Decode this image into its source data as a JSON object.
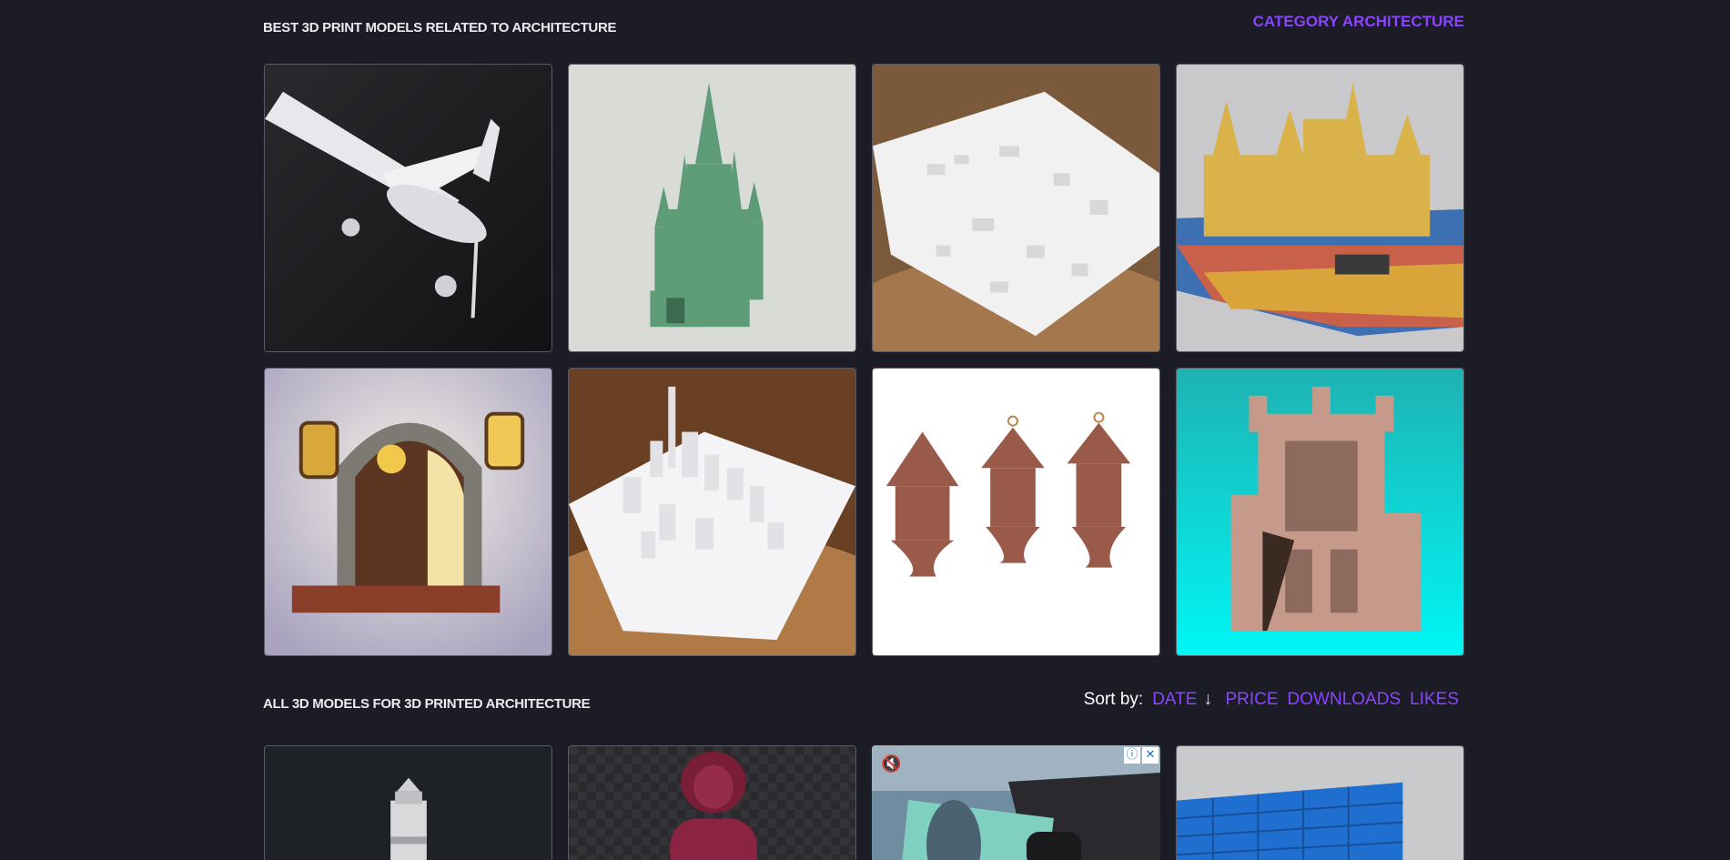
{
  "header": {
    "best_title": "BEST 3D PRINT MODELS RELATED TO ARCHITECTURE",
    "category_link": "CATEGORY ARCHITECTURE"
  },
  "best_models": [
    {
      "name": "airplane-model-card",
      "icon": "airplane-image"
    },
    {
      "name": "green-castle-model-card",
      "icon": "castle-image"
    },
    {
      "name": "city-map-model-card",
      "icon": "city-map-image"
    },
    {
      "name": "hogwarts-model-card",
      "icon": "hogwarts-image"
    },
    {
      "name": "fairy-door-model-card",
      "icon": "fairy-door-image"
    },
    {
      "name": "white-city-model-card",
      "icon": "city-skyline-image"
    },
    {
      "name": "tree-houses-model-card",
      "icon": "tree-house-image"
    },
    {
      "name": "cathedral-model-card",
      "icon": "cathedral-image"
    }
  ],
  "all_models": {
    "title": "ALL 3D MODELS FOR 3D PRINTED ARCHITECTURE",
    "sort": {
      "label": "Sort by:",
      "options": [
        "DATE",
        "PRICE",
        "DOWNLOADS",
        "LIKES"
      ],
      "active": "DATE",
      "direction_icon": "arrow-down-icon",
      "direction_glyph": "↓"
    }
  },
  "ad": {
    "info_glyph": "ⓘ",
    "close_glyph": "✕",
    "mute_glyph": "🔇"
  },
  "colors": {
    "background": "#1c1c26",
    "accent": "#8a44ff",
    "text": "#e9e9ee"
  }
}
